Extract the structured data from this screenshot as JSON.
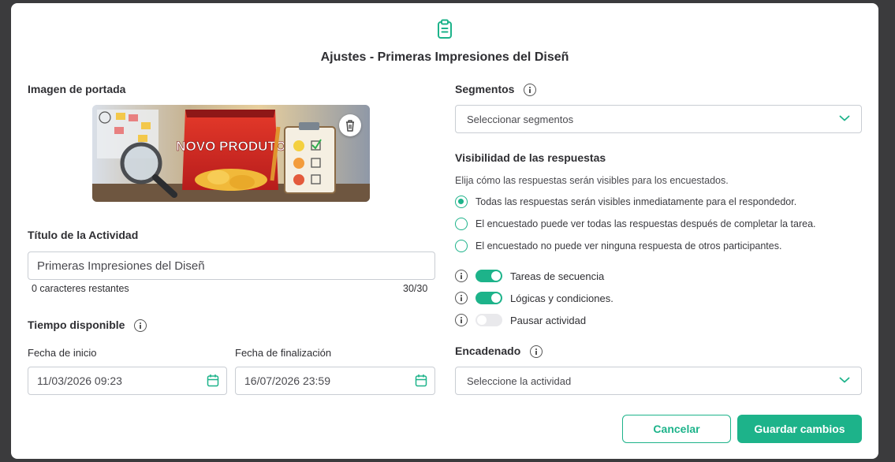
{
  "modal": {
    "title": "Ajustes - Primeras Impresiones del Diseñ",
    "accent_color": "#1db38a"
  },
  "cover": {
    "label": "Imagen de portada",
    "bag_text": "NOVO PRODUTO"
  },
  "activity_title": {
    "label": "Título de la Actividad",
    "value": "Primeras Impresiones del Diseñ",
    "remaining": "0 caracteres restantes",
    "counter": "30/30"
  },
  "time": {
    "label": "Tiempo disponible",
    "start_label": "Fecha de inicio",
    "start_value": "11/03/2026 09:23",
    "end_label": "Fecha de finalización",
    "end_value": "16/07/2026 23:59"
  },
  "segments": {
    "label": "Segmentos",
    "placeholder": "Seleccionar segmentos"
  },
  "visibility": {
    "label": "Visibilidad de las respuestas",
    "description": "Elija cómo las respuestas serán visibles para los encuestados.",
    "options": [
      {
        "text": "Todas las respuestas serán visibles inmediatamente para el respondedor.",
        "selected": true
      },
      {
        "text": "El encuestado puede ver todas las respuestas después de completar la tarea.",
        "selected": false
      },
      {
        "text": "El encuestado no puede ver ninguna respuesta de otros participantes.",
        "selected": false
      }
    ]
  },
  "toggles": [
    {
      "label": "Tareas de secuencia",
      "on": true
    },
    {
      "label": "Lógicas y condiciones.",
      "on": true
    },
    {
      "label": "Pausar actividad",
      "on": false
    }
  ],
  "chaining": {
    "label": "Encadenado",
    "placeholder": "Seleccione la actividad"
  },
  "buttons": {
    "cancel": "Cancelar",
    "save": "Guardar cambios"
  }
}
